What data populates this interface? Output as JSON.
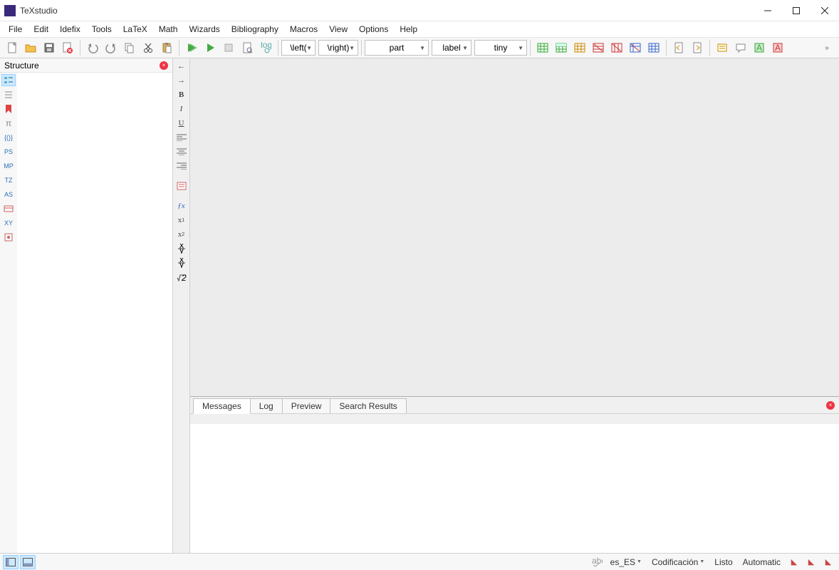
{
  "title": "TeXstudio",
  "menu": [
    "File",
    "Edit",
    "Idefix",
    "Tools",
    "LaTeX",
    "Math",
    "Wizards",
    "Bibliography",
    "Macros",
    "View",
    "Options",
    "Help"
  ],
  "combos": {
    "left": "\\left(",
    "right": "\\right)",
    "part": "part",
    "label": "label",
    "tiny": "tiny"
  },
  "sidebar": {
    "title": "Structure",
    "icons": [
      "PS",
      "MP",
      "TZ",
      "AS",
      "XY"
    ]
  },
  "tabs": [
    "Messages",
    "Log",
    "Preview",
    "Search Results"
  ],
  "status": {
    "lang": "es_ES",
    "encoding": "Codificación",
    "ready": "Listo",
    "mode": "Automatic"
  }
}
